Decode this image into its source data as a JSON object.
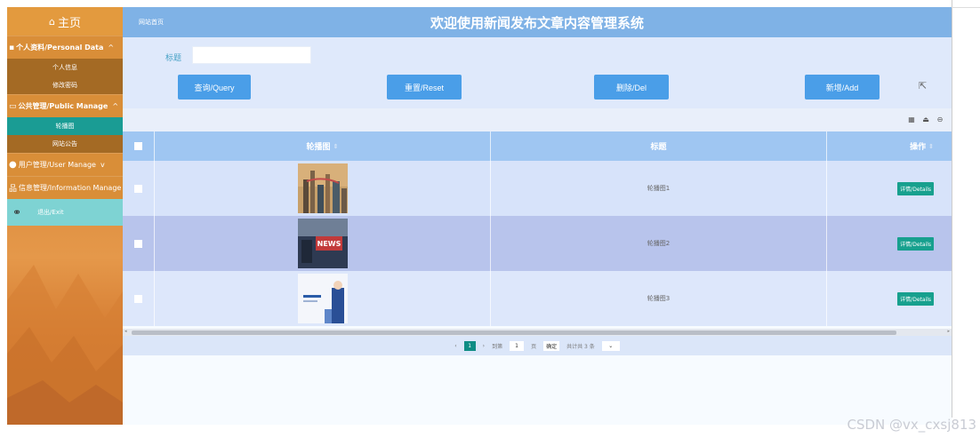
{
  "sidebar": {
    "home_label": "主页",
    "groups": [
      {
        "label": "个人资料/Personal Data",
        "icon": "user-card-icon",
        "items": [
          "个人信息",
          "修改密码"
        ]
      },
      {
        "label": "公共管理/Public Manage",
        "icon": "monitor-icon",
        "items": [
          "轮播图",
          "网站公告"
        ],
        "active_item": "轮播图"
      },
      {
        "label": "用户管理/User Manage",
        "icon": "users-icon",
        "items": []
      },
      {
        "label": "信息管理/Information Manage",
        "icon": "sitemap-icon",
        "items": []
      }
    ],
    "exit_label": "退出/Exit"
  },
  "topbar": {
    "breadcrumb": "网站首页",
    "title": "欢迎使用新闻发布文章内容管理系统"
  },
  "filter": {
    "title_label": "标题",
    "title_value": "",
    "query_button": "查询/Query",
    "reset_button": "重置/Reset",
    "delete_button": "删除/Del",
    "add_button": "新增/Add"
  },
  "table": {
    "headers": {
      "image": "轮播图",
      "title": "标题",
      "actions": "操作"
    },
    "rows": [
      {
        "title": "轮播图1",
        "action": "详情/Details"
      },
      {
        "title": "轮播图2",
        "action": "详情/Details"
      },
      {
        "title": "轮播图3",
        "action": "详情/Details"
      }
    ]
  },
  "pager": {
    "current_page": "1",
    "goto_label": "到第",
    "goto_value": "1",
    "page_unit": "页",
    "confirm": "确定",
    "total": "共计共 3 条"
  },
  "watermark": "CSDN @vx_cxsj813",
  "colors": {
    "sidebar_orange": "#e39a3e",
    "active_teal": "#1a9c94",
    "topbar_blue": "#7fb2e6",
    "button_blue": "#4a9ee8",
    "detail_green": "#17a08e"
  }
}
